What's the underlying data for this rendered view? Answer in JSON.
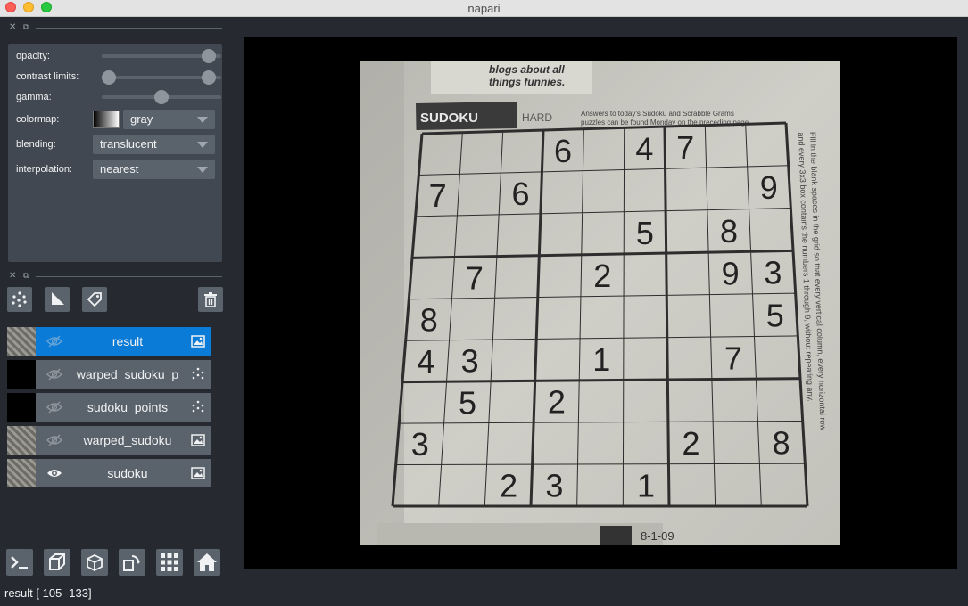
{
  "window": {
    "title": "napari"
  },
  "layer_controls": {
    "opacity_label": "opacity:",
    "opacity_value": 0.95,
    "contrast_label": "contrast limits:",
    "contrast_range": [
      0.0,
      0.95
    ],
    "gamma_label": "gamma:",
    "gamma_value": 0.5,
    "colormap_label": "colormap:",
    "colormap_value": "gray",
    "blending_label": "blending:",
    "blending_value": "translucent",
    "interpolation_label": "interpolation:",
    "interpolation_value": "nearest"
  },
  "layer_buttons": [
    "new-points-icon",
    "new-shapes-icon",
    "new-labels-icon",
    "delete-layer-icon"
  ],
  "layers": [
    {
      "name": "result",
      "visible": false,
      "type": "image",
      "selected": true
    },
    {
      "name": "warped_sudoku_p",
      "visible": false,
      "type": "points",
      "selected": false
    },
    {
      "name": "sudoku_points",
      "visible": false,
      "type": "points",
      "selected": false
    },
    {
      "name": "warped_sudoku",
      "visible": false,
      "type": "image",
      "selected": false
    },
    {
      "name": "sudoku",
      "visible": true,
      "type": "image",
      "selected": false
    }
  ],
  "bottom_buttons": [
    "console-icon",
    "ndisplay-3d-icon",
    "roll-axes-icon",
    "transpose-axes-icon",
    "grid-icon",
    "home-icon"
  ],
  "image": {
    "header_text": "blogs about all things funnies.",
    "sudoku_title": "SUDOKU",
    "difficulty": "HARD",
    "answers_text": "Answers to today's Sudoku and Scrabble Grams puzzles can be found Monday on the preceding page.",
    "side_text": "Fill in the blank spaces in the grid so that every vertical column, every horizontal row and every 3x3 box contains the numbers 1 through 9, without repeating any.",
    "date": "8-1-09",
    "grid": [
      [
        "",
        "",
        "",
        "6",
        "",
        "4",
        "7",
        "",
        ""
      ],
      [
        "7",
        "",
        "6",
        "",
        "",
        "",
        "",
        "",
        "9"
      ],
      [
        "",
        "",
        "",
        "",
        "",
        "5",
        "",
        "8",
        ""
      ],
      [
        "",
        "7",
        "",
        "",
        "2",
        "",
        "",
        "9",
        "3"
      ],
      [
        "8",
        "",
        "",
        "",
        "",
        "",
        "",
        "",
        "5"
      ],
      [
        "4",
        "3",
        "",
        "",
        "1",
        "",
        "",
        "7",
        ""
      ],
      [
        "",
        "5",
        "",
        "2",
        "",
        "",
        "",
        "",
        ""
      ],
      [
        "3",
        "",
        "",
        "",
        "",
        "",
        "2",
        "",
        "8"
      ],
      [
        "",
        "",
        "2",
        "3",
        "",
        "1",
        "",
        "",
        ""
      ]
    ]
  },
  "status": {
    "text": "result [ 105 -133]"
  },
  "colors": {
    "accent": "#0a7bd6",
    "background": "#262930",
    "panel": "#414851",
    "control": "#5a626c"
  }
}
